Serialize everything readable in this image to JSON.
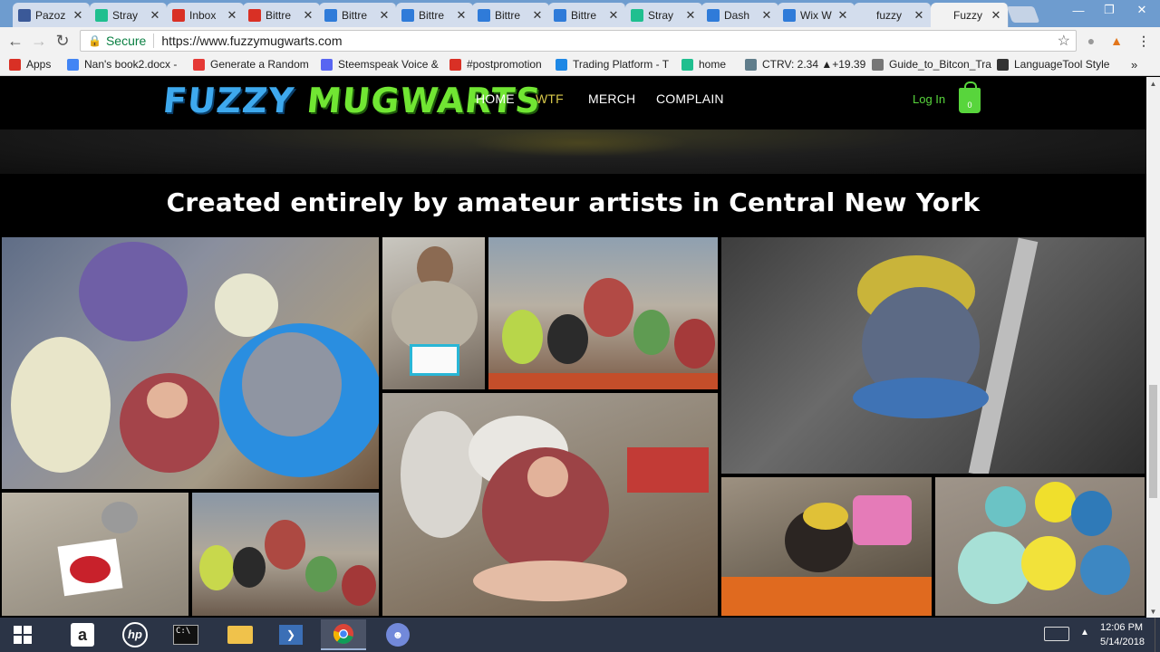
{
  "tabs": [
    {
      "title": "Pazoz",
      "favicon_color": "#3b5998"
    },
    {
      "title": "Stray",
      "favicon_color": "#1fbf8f"
    },
    {
      "title": "Inbox",
      "favicon_color": "#d93025"
    },
    {
      "title": "Bittre",
      "favicon_color": "#d93025"
    },
    {
      "title": "Bittre",
      "favicon_color": "#2f7bd9"
    },
    {
      "title": "Bittre",
      "favicon_color": "#2f7bd9"
    },
    {
      "title": "Bittre",
      "favicon_color": "#2f7bd9"
    },
    {
      "title": "Bittre",
      "favicon_color": "#2f7bd9"
    },
    {
      "title": "Stray",
      "favicon_color": "#1fbf8f"
    },
    {
      "title": "Dash",
      "favicon_color": "#2f7bd9"
    },
    {
      "title": "Wix W",
      "favicon_color": "#2f7bd9"
    },
    {
      "title": "fuzzy",
      "favicon_color": ""
    },
    {
      "title": "Fuzzy",
      "favicon_color": ""
    }
  ],
  "toolbar": {
    "secure_label": "Secure",
    "url": "https://www.fuzzymugwarts.com"
  },
  "bookmarks": [
    {
      "label": "Apps",
      "icon": "apps-grid-icon",
      "color": "#d93025"
    },
    {
      "label": "Nan's book2.docx - ",
      "icon": "doc-icon",
      "color": "#4285f4"
    },
    {
      "label": "Generate a Random",
      "icon": "f-icon",
      "color": "#e53935"
    },
    {
      "label": "Steemspeak Voice &",
      "icon": "discord-icon",
      "color": "#5865f2"
    },
    {
      "label": "#postpromotion",
      "icon": "101-icon",
      "color": "#d93025"
    },
    {
      "label": "Trading Platform - T",
      "icon": "t-icon",
      "color": "#1e88e5"
    },
    {
      "label": "home",
      "icon": "home-icon",
      "color": "#1fbf8f"
    },
    {
      "label": "CTRV: 2.34 ▲+19.39",
      "icon": "cloud-icon",
      "color": "#607d8b"
    },
    {
      "label": "Guide_to_Bitcon_Tra",
      "icon": "page-icon",
      "color": "#777777"
    },
    {
      "label": "LanguageTool Style",
      "icon": "lt-icon",
      "color": "#333333"
    }
  ],
  "site": {
    "logo_word1": "FUZZY",
    "logo_word2": "MUGWARTS",
    "nav": {
      "home": "HOME",
      "wtf": "WTF",
      "merch": "MERCH",
      "complain": "COMPLAIN"
    },
    "login": "Log In",
    "cart_count": "0",
    "tagline": "Created entirely by amateur artists in Central New York"
  },
  "taskbar": {
    "time": "12:06 PM",
    "date": "5/14/2018"
  }
}
